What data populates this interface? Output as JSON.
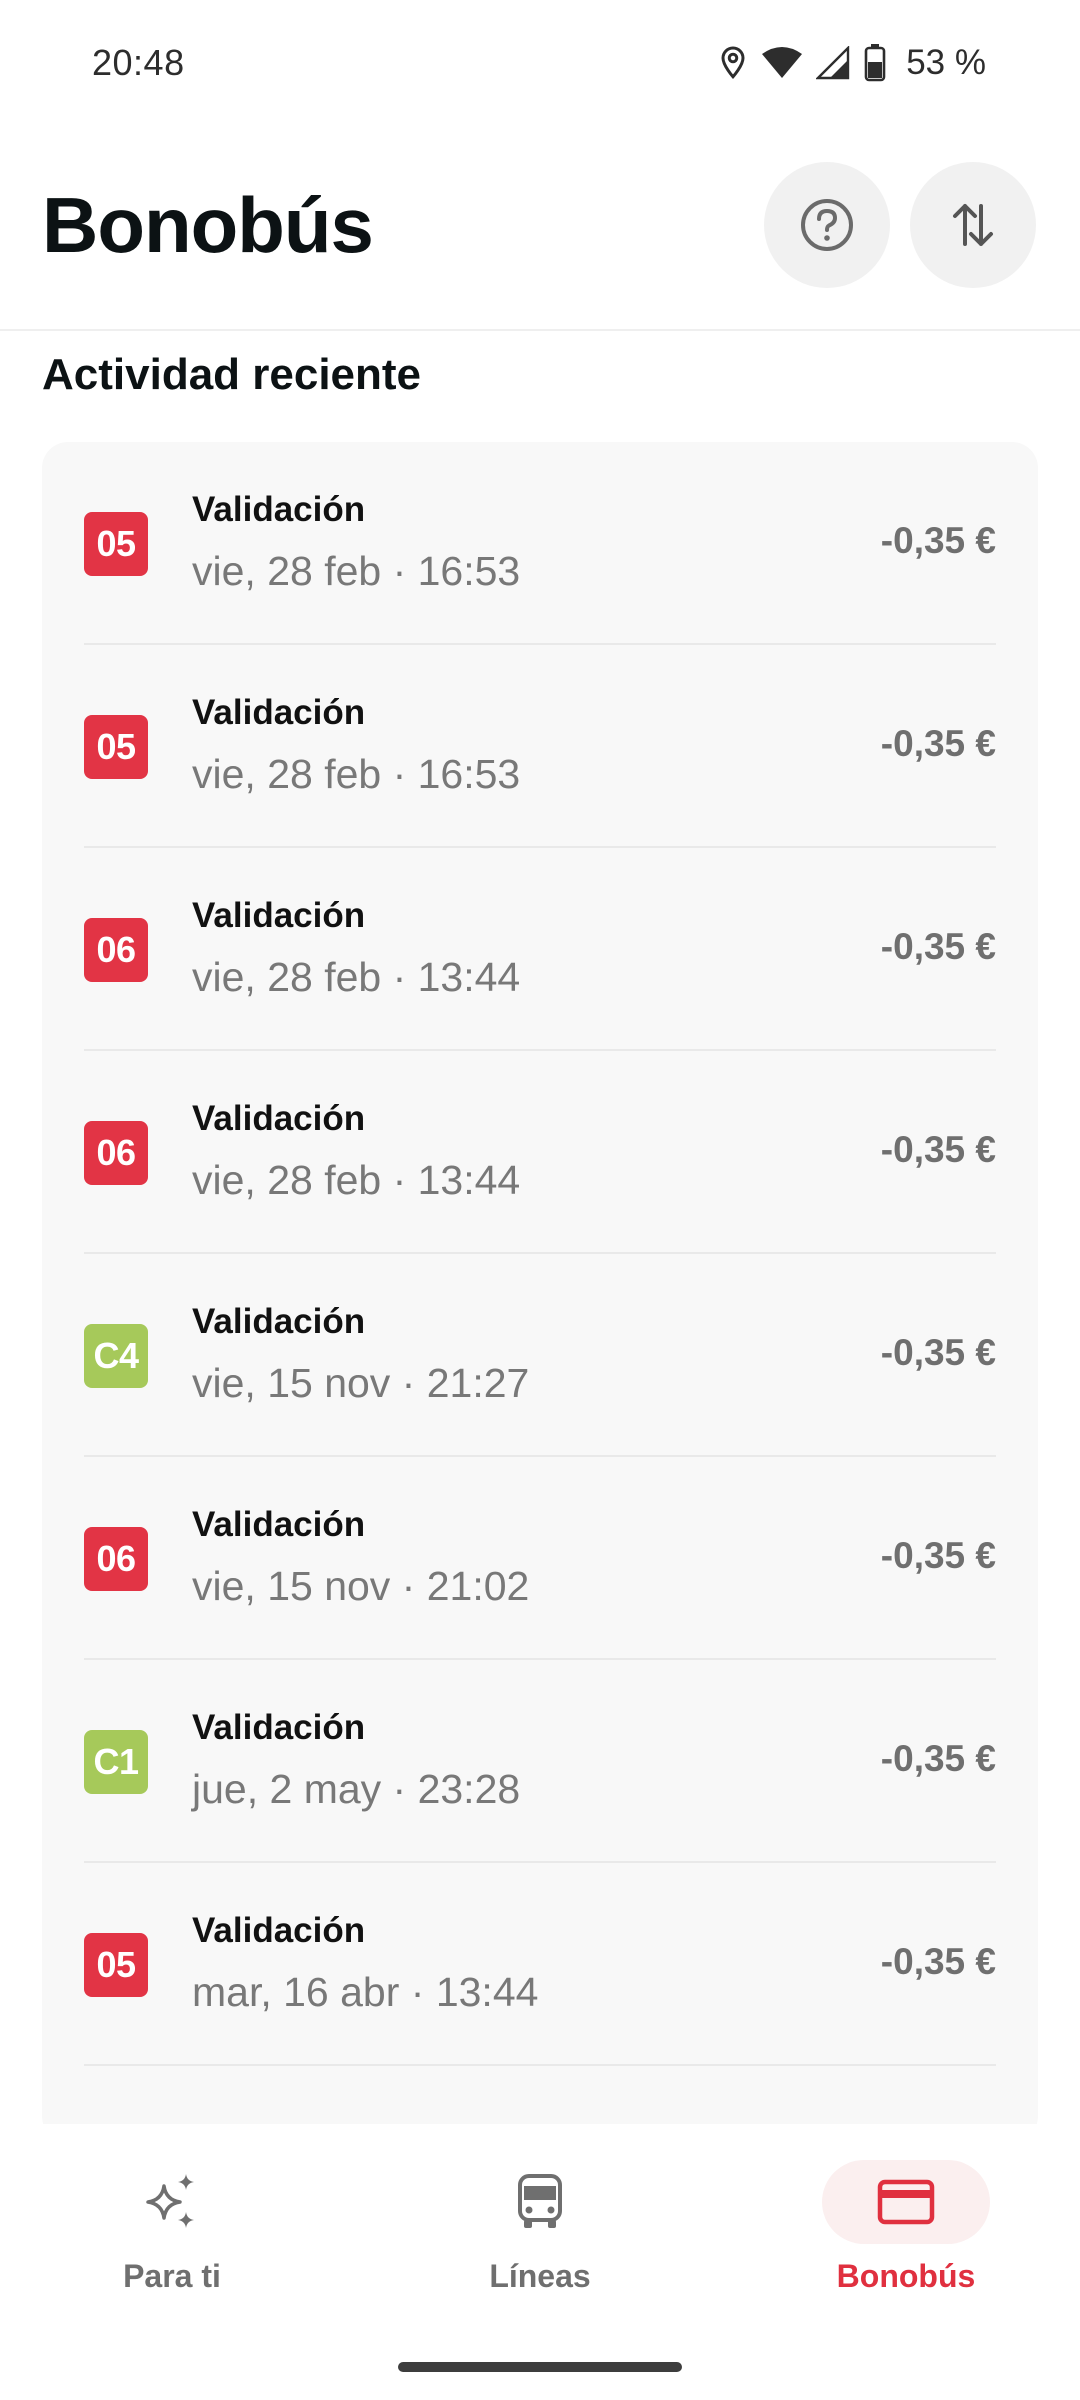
{
  "status_bar": {
    "time": "20:48",
    "battery": "53 %"
  },
  "header": {
    "title": "Bonobús"
  },
  "activity": {
    "title": "Actividad reciente",
    "items": [
      {
        "line": "05",
        "line_color": "#e23445",
        "title": "Validación",
        "date": "vie, 28 feb · 16:53",
        "amount": "-0,35 €"
      },
      {
        "line": "05",
        "line_color": "#e23445",
        "title": "Validación",
        "date": "vie, 28 feb · 16:53",
        "amount": "-0,35 €"
      },
      {
        "line": "06",
        "line_color": "#e23445",
        "title": "Validación",
        "date": "vie, 28 feb · 13:44",
        "amount": "-0,35 €"
      },
      {
        "line": "06",
        "line_color": "#e23445",
        "title": "Validación",
        "date": "vie, 28 feb · 13:44",
        "amount": "-0,35 €"
      },
      {
        "line": "C4",
        "line_color": "#a6c95a",
        "title": "Validación",
        "date": "vie, 15 nov · 21:27",
        "amount": "-0,35 €"
      },
      {
        "line": "06",
        "line_color": "#e23445",
        "title": "Validación",
        "date": "vie, 15 nov · 21:02",
        "amount": "-0,35 €"
      },
      {
        "line": "C1",
        "line_color": "#a6c95a",
        "title": "Validación",
        "date": "jue, 2 may · 23:28",
        "amount": "-0,35 €"
      },
      {
        "line": "05",
        "line_color": "#e23445",
        "title": "Validación",
        "date": "mar, 16 abr · 13:44",
        "amount": "-0,35 €"
      }
    ]
  },
  "bottom_nav": {
    "items": [
      {
        "label": "Para ti",
        "icon": "sparkles-icon"
      },
      {
        "label": "Líneas",
        "icon": "bus-icon"
      },
      {
        "label": "Bonobús",
        "icon": "card-icon",
        "active": true
      }
    ]
  },
  "colors": {
    "accent": "#e0303f",
    "red_line": "#e23445",
    "green_line": "#a6c95a"
  }
}
